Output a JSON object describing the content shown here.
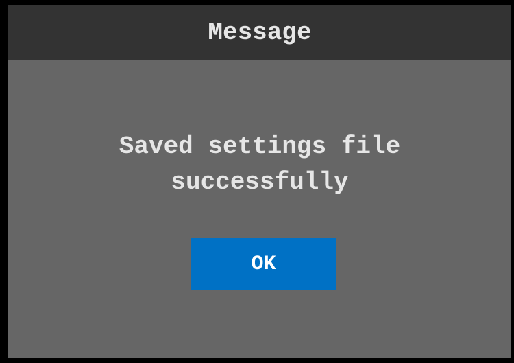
{
  "dialog": {
    "title": "Message",
    "message_lines": [
      "Saved settings file",
      "successfully"
    ],
    "ok_label": "OK"
  },
  "colors": {
    "frame": "#000000",
    "titlebar": "#333333",
    "body": "#666666",
    "text": "#e6e6e6",
    "ok_button": "#0071c5"
  }
}
